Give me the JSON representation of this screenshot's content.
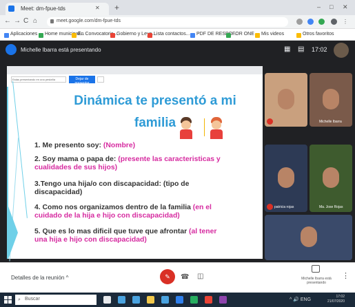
{
  "browser": {
    "tab_title": "Meet: dm-fpue-tds",
    "new_tab_label": "+",
    "window_controls": [
      "–",
      "□",
      "✕"
    ],
    "url": "meet.google.com/dm-fpue-tds",
    "nav": [
      "←",
      "→",
      "C",
      "⌂"
    ],
    "bookmarks": [
      {
        "label": "Aplicaciones",
        "color": "#4285f4"
      },
      {
        "label": "Home municipali...",
        "color": "#34a853"
      },
      {
        "label": "En Convocatoria...",
        "color": "#fbbc04"
      },
      {
        "label": "Gobierno y Leye...",
        "color": "#ea4335"
      },
      {
        "label": "Lista contactos...",
        "color": "#ea4335"
      },
      {
        "label": "PDF DE RESPO...",
        "color": "#4285f4"
      },
      {
        "label": "FOR ONE",
        "color": "#34a853"
      },
      {
        "label": "Mis videos",
        "color": "#fbbc04"
      },
      {
        "label": "Otros favoritos",
        "color": "#fbbc04"
      }
    ]
  },
  "meet": {
    "presenter_text": "Michelle Ibarra está presentando",
    "clock": "17:02",
    "slide": {
      "toolbar_field": "Estás presentando en una pestaña",
      "toolbar_button": "Dejar de presentar",
      "title_line1": "Dinámica te presentó a mi",
      "title_line2": "familia",
      "items": [
        {
          "lines": [
            [
              {
                "t": "1. Me presento soy: ",
                "a": false
              },
              {
                "t": "(Nombre)",
                "a": true
              }
            ]
          ]
        },
        {
          "lines": [
            [
              {
                "t": "2. Soy mama o papa de: ",
                "a": false
              },
              {
                "t": "(presente las caracteristicas y",
                "a": true
              }
            ],
            [
              {
                "t": "cualidades de sus hijos)",
                "a": true
              }
            ]
          ]
        },
        {
          "lines": [
            [
              {
                "t": "3.Tengo una hija/o con discapacidad: (tipo de",
                "a": false
              }
            ],
            [
              {
                "t": "discapacidad)",
                "a": false
              }
            ]
          ]
        },
        {
          "lines": [
            [
              {
                "t": "4. Como nos organizamos dentro de la familia ",
                "a": false
              },
              {
                "t": "(en el",
                "a": true
              }
            ],
            [
              {
                "t": "cuidado de la hija e hijo con discapacidad)",
                "a": true
              }
            ]
          ]
        },
        {
          "lines": [
            [
              {
                "t": "5. Que es lo mas dificil que tuve que afrontar ",
                "a": false
              },
              {
                "t": "(al tener",
                "a": true
              }
            ],
            [
              {
                "t": "una hija e hijo con discapacidad)",
                "a": true
              }
            ]
          ]
        }
      ]
    },
    "participants": [
      {
        "name": "",
        "bg": "#c9a07e"
      },
      {
        "name": "Michelle Ibarra",
        "bg": "#7a5a4a"
      },
      {
        "name": "patricia rojas",
        "bg": "#2d3a55"
      },
      {
        "name": "Ma. Jose Rojas",
        "bg": "#3e5b2e"
      },
      {
        "name": "",
        "bg": "#3a4a6a"
      }
    ],
    "bottom": {
      "meeting_details": "Detalles de la reunión ^",
      "present_now": "Michelle Ibarra está presentando"
    }
  },
  "taskbar": {
    "search_placeholder": "Buscar",
    "time": "17:02",
    "date": "21/07/2020",
    "app_colors": [
      "#e8eaed",
      "#4aa3e0",
      "#4aa3e0",
      "#f2c94c",
      "#4aa3e0",
      "#2f80ed",
      "#27ae60",
      "#ea4335",
      "#8e44ad"
    ],
    "tray": "^ 🔊 ENG"
  },
  "colors": {
    "slide_title": "#2e9bd6",
    "answer_text": "#d62ba0",
    "mic_off": "#d93025",
    "meet_bg": "#202124"
  }
}
